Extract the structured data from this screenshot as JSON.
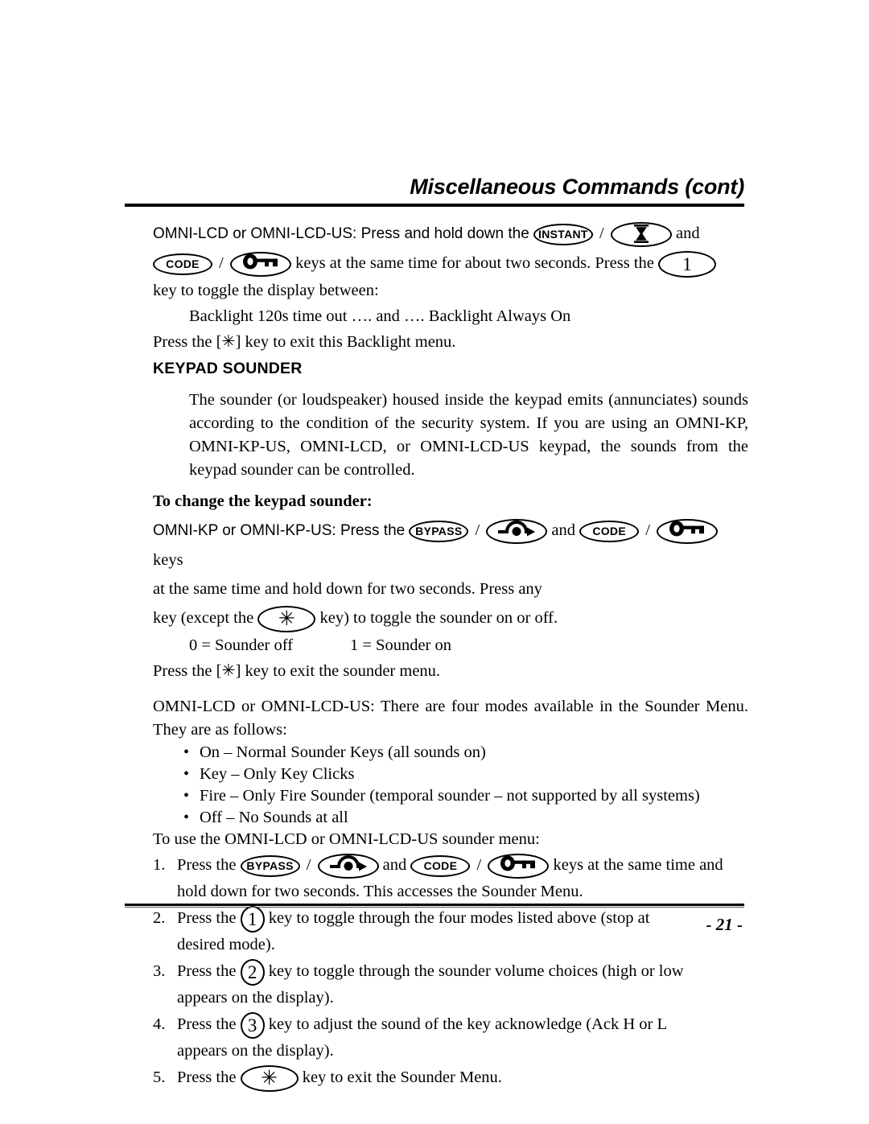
{
  "header": {
    "title": "Miscellaneous Commands (cont)"
  },
  "footer": {
    "page_number": "- 21 -"
  },
  "icons": {
    "instant_label": "INSTANT",
    "code_label": "CODE",
    "bypass_label": "BYPASS",
    "key_one": "1",
    "key_two": "2",
    "key_three": "3",
    "star": "✳",
    "hourglass_name": "hourglass-icon",
    "lockkey_name": "key-icon",
    "bypass_name": "bypass-arrow-icon"
  },
  "backlight": {
    "line1_a": "OMNI-LCD or OMNI-LCD-US: Press and hold down the",
    "line1_sep": "/",
    "line1_b": "and",
    "line2_sep": "/",
    "line2_a": "keys at the same time for about two seconds. Press the",
    "line3": "key to toggle the display between:",
    "line4": "Backlight 120s time out …. and …. Backlight Always On",
    "line5": "Press the [✳] key to exit this Backlight menu."
  },
  "sounder": {
    "heading": "KEYPAD SOUNDER",
    "intro": "The sounder (or loudspeaker) housed inside the keypad emits (annunciates) sounds according to the condition of the security system. If you are using an OMNI-KP, OMNI-KP-US, OMNI-LCD, or OMNI-LCD-US keypad, the sounds from the keypad sounder can be controlled.",
    "subheading": "To change the keypad sounder:",
    "kp_line1_a": "OMNI-KP or OMNI-KP-US: Press the",
    "kp_sep1": "/",
    "kp_and": "and",
    "kp_sep2": "/",
    "kp_line1_b": "keys",
    "kp_line2": "at the same time and hold down for two seconds. Press any",
    "kp_line3_a": "key (except the",
    "kp_line3_b": "key) to toggle the sounder on or off.",
    "off_value": "0 = Sounder off",
    "on_value": "1 = Sounder on",
    "exit_line": "Press the [✳] key to exit the sounder menu.",
    "lcd_intro": "OMNI-LCD or OMNI-LCD-US: There are four modes available in the Sounder Menu. They are as follows:",
    "modes": [
      "On – Normal Sounder Keys (all sounds on)",
      "Key – Only Key Clicks",
      "Fire – Only Fire Sounder (temporal sounder – not supported by all systems)",
      "Off – No Sounds at all"
    ],
    "menu_intro": "To use the OMNI-LCD or OMNI-LCD-US sounder menu:"
  },
  "steps": {
    "s1_num": "1.",
    "s1_a": "Press the",
    "s1_sep1": "/",
    "s1_and": "and",
    "s1_sep2": "/",
    "s1_b": "keys at the same time and",
    "s1_cont": "hold down for two seconds. This accesses the Sounder Menu.",
    "s2_num": "2.",
    "s2_a": "Press the",
    "s2_b": "key to toggle through the four modes listed above (stop at",
    "s2_cont": "desired mode).",
    "s3_num": "3.",
    "s3_a": "Press the",
    "s3_b": "key to toggle through the sounder volume choices (high or low",
    "s3_cont": "appears on the display).",
    "s4_num": "4.",
    "s4_a": "Press the",
    "s4_b": "key to adjust the sound of the key acknowledge (Ack H or L",
    "s4_cont": "appears on the display).",
    "s5_num": "5.",
    "s5_a": "Press the",
    "s5_b": "key to exit the Sounder Menu."
  }
}
